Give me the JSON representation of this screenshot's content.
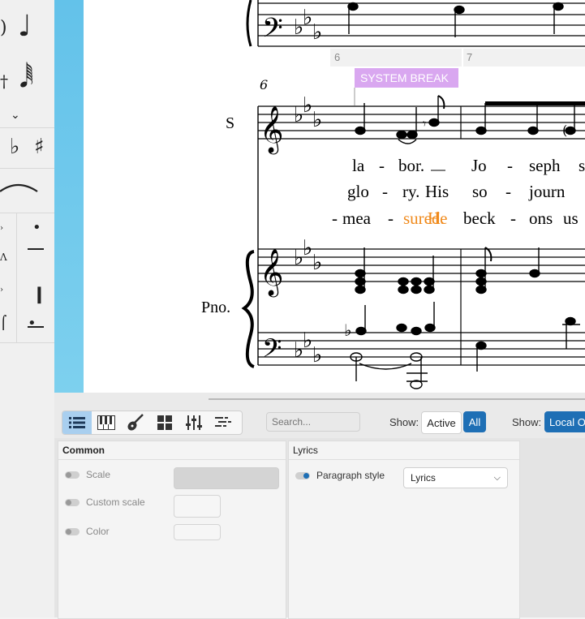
{
  "score": {
    "measure_numbers": [
      "6",
      "7"
    ],
    "system_measure_number": "6",
    "system_break_label": "SYSTEM BREAK",
    "instruments": [
      "S",
      "Pno."
    ],
    "lyrics": [
      [
        {
          "t": "la"
        },
        {
          "t": "-"
        },
        {
          "t": "bor."
        },
        {
          "t": "Jo"
        },
        {
          "t": "-"
        },
        {
          "t": "seph"
        },
        {
          "t": "s"
        }
      ],
      [
        {
          "t": "glo"
        },
        {
          "t": "-"
        },
        {
          "t": "ry."
        },
        {
          "t": "His"
        },
        {
          "t": "so"
        },
        {
          "t": "-"
        },
        {
          "t": "journ"
        }
      ],
      [
        {
          "t": "-"
        },
        {
          "t": "mea"
        },
        {
          "t": "-"
        },
        {
          "t": "sured."
        },
        {
          "t": "He"
        },
        {
          "t": "beck"
        },
        {
          "t": "-"
        },
        {
          "t": "ons"
        },
        {
          "t": "us"
        }
      ]
    ],
    "highlight_color": "#f08a1c"
  },
  "palette": {
    "items": [
      "quarter-note",
      "sixty-fourth-note",
      "chevron-down",
      "flat",
      "sharp",
      "slur",
      "staccato",
      "tenuto",
      "staccatissimo",
      "portato"
    ]
  },
  "toolbar": {
    "tabs": [
      "list-icon",
      "piano-icon",
      "guitar-icon",
      "grid-icon",
      "mixer-icon",
      "outline-icon"
    ],
    "search_placeholder": "Search...",
    "show_label_1": "Show:",
    "active_label": "Active",
    "all_label": "All",
    "show_label_2": "Show:",
    "local_label": "Local O"
  },
  "common_panel": {
    "title": "Common",
    "scale_label": "Scale",
    "custom_scale_label": "Custom scale",
    "color_label": "Color"
  },
  "lyrics_panel": {
    "title": "Lyrics",
    "paragraph_style_label": "Paragraph style",
    "paragraph_style_value": "Lyrics"
  },
  "colors": {
    "accent": "#1e6fb5",
    "system_break_bg": "#d9a7f0",
    "score_blue": "#63c2ea"
  }
}
